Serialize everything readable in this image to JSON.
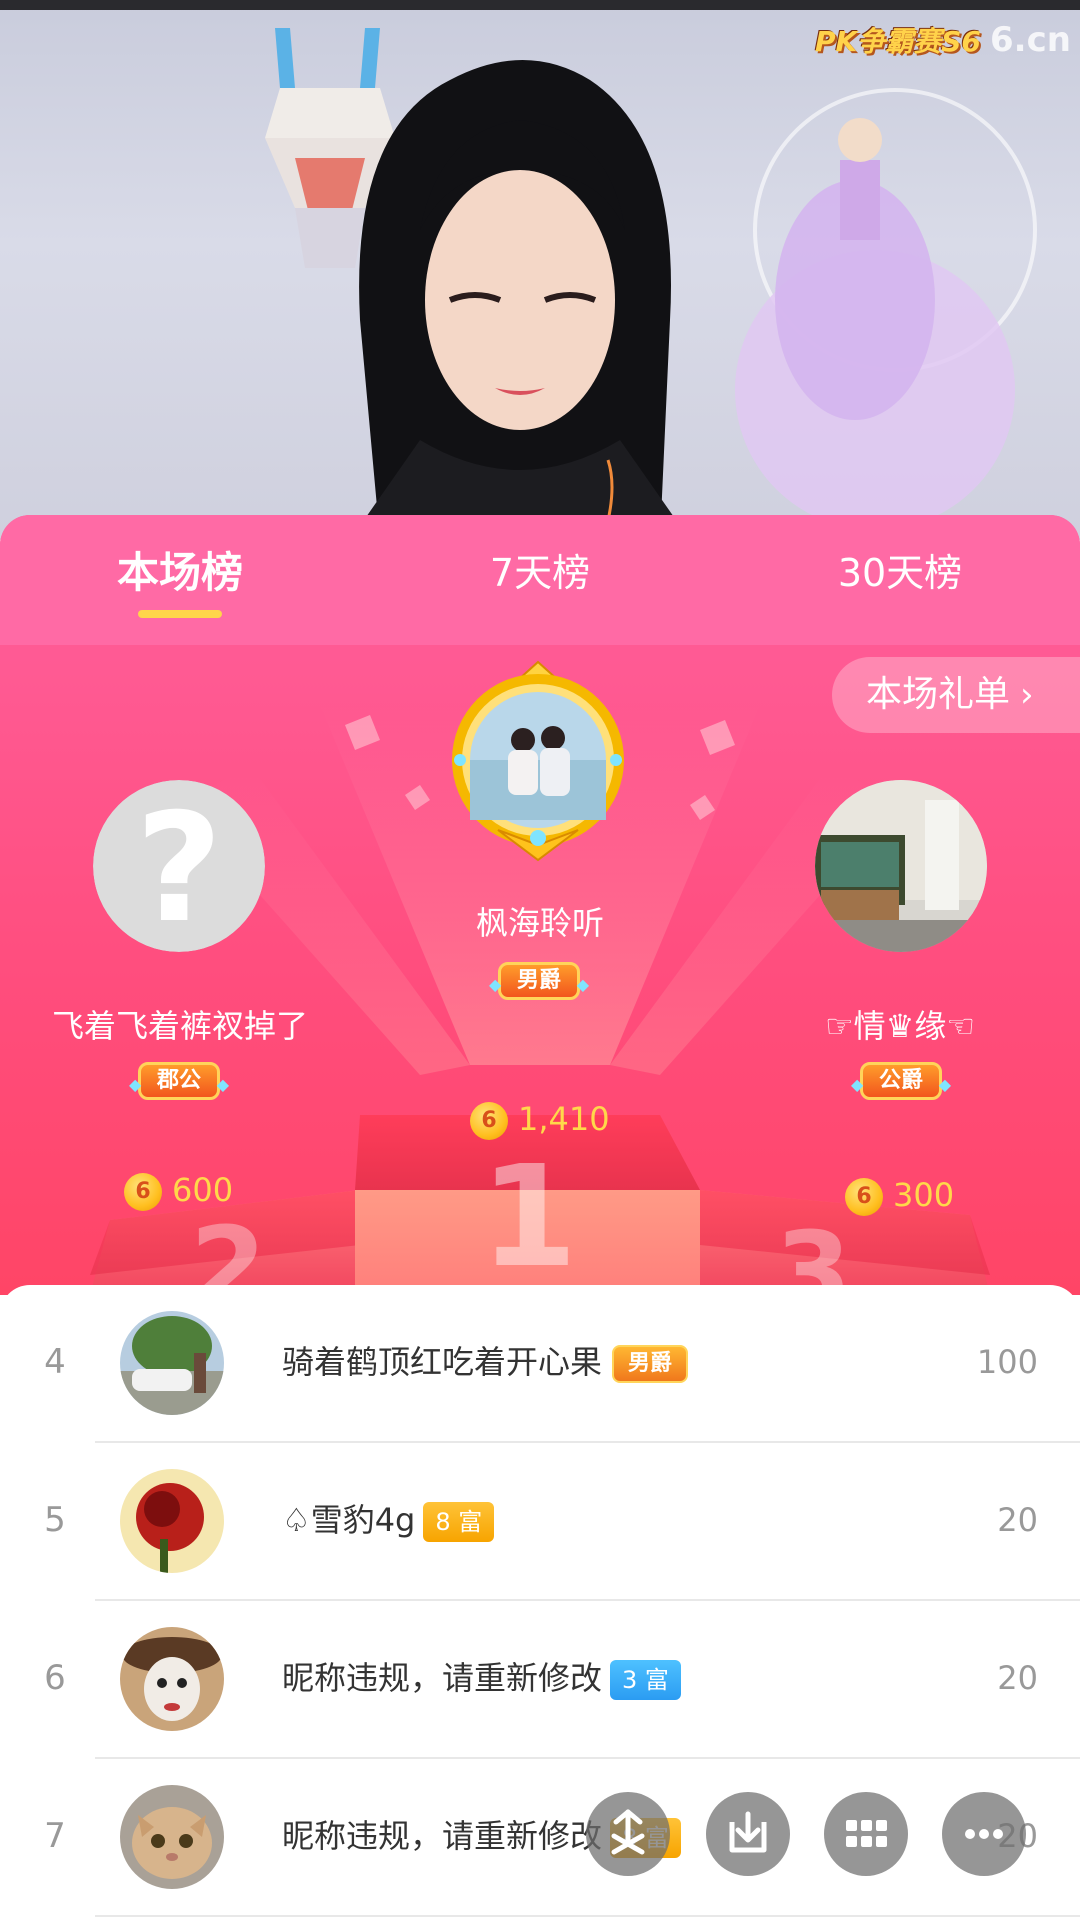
{
  "overlay": {
    "pk_logo": "PK争霸赛S6",
    "site_logo": "6.cn"
  },
  "tabs": [
    {
      "label": "本场榜",
      "active": true
    },
    {
      "label": "7天榜",
      "active": false
    },
    {
      "label": "30天榜",
      "active": false
    }
  ],
  "gift_list_button": {
    "label": "本场礼单",
    "chevron": "›"
  },
  "podium": {
    "first": {
      "rank": 1,
      "nickname": "枫海聆听",
      "title": "男爵",
      "coins": "1,410"
    },
    "second": {
      "rank": 2,
      "nickname": "飞着飞着裤衩掉了",
      "title": "郡公",
      "coins": "600"
    },
    "third": {
      "rank": 3,
      "nickname": "☞情♛缘☜",
      "title": "公爵",
      "coins": "300"
    },
    "coin_symbol": "6"
  },
  "list": [
    {
      "rank": "4",
      "nickname": "骑着鹤顶红吃着开心果",
      "badge": "男爵",
      "badge_type": "title",
      "score": "100"
    },
    {
      "rank": "5",
      "nickname": "♤雪豹4g",
      "badge": "8 富",
      "badge_type": "gold",
      "score": "20"
    },
    {
      "rank": "6",
      "nickname": "昵称违规，请重新修改",
      "badge": "3 富",
      "badge_type": "blue",
      "score": "20"
    },
    {
      "rank": "7",
      "nickname": "昵称违规，请重新修改",
      "badge": "8 富",
      "badge_type": "gold",
      "score": "20"
    }
  ],
  "fabs": [
    {
      "icon": "share-icon"
    },
    {
      "icon": "download-icon"
    },
    {
      "icon": "grid-icon"
    },
    {
      "icon": "more-icon"
    }
  ],
  "colors": {
    "panel_pink": "#ff5a93",
    "accent_yellow": "#ffd54a",
    "coin_gold": "#ffd84a"
  }
}
